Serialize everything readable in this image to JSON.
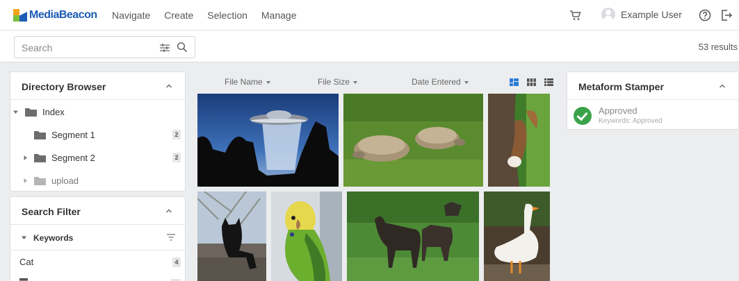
{
  "app": {
    "brand": "MediaBeacon"
  },
  "nav": {
    "items": [
      "Navigate",
      "Create",
      "Selection",
      "Manage"
    ]
  },
  "user": {
    "name": "Example User"
  },
  "search": {
    "placeholder": "Search",
    "results": "53 results"
  },
  "directory": {
    "title": "Directory Browser",
    "items": [
      {
        "label": "Index",
        "count": ""
      },
      {
        "label": "Segment 1",
        "count": "2"
      },
      {
        "label": "Segment 2",
        "count": "2"
      },
      {
        "label": "upload",
        "count": ""
      }
    ]
  },
  "filter": {
    "title": "Search Filter",
    "section": "Keywords",
    "items": [
      {
        "label": "Cat",
        "count": "4"
      }
    ]
  },
  "sort": {
    "fields": [
      "File Name",
      "File Size",
      "Date Entered"
    ]
  },
  "stamper": {
    "title": "Metaform Stamper",
    "status": "Approved",
    "detail": "Keywords: Approved"
  },
  "thumbnails": [
    "ufo",
    "tortoises",
    "squirrel",
    "cat",
    "parakeet",
    "moose",
    "goose"
  ],
  "colors": {
    "brand": "#1d5cb5",
    "approved": "#3aa34a",
    "view_active": "#2b7bd6"
  }
}
